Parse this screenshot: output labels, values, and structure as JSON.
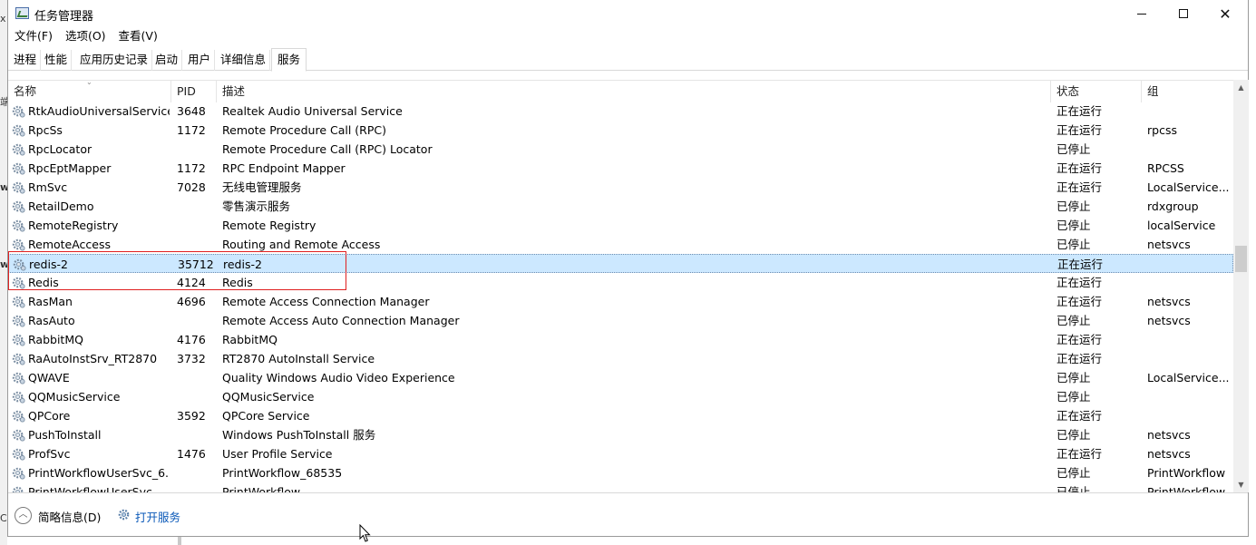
{
  "window": {
    "title": "任务管理器",
    "controls": {
      "minimize": "minimize",
      "maximize": "maximize",
      "close": "✕"
    }
  },
  "menu": [
    "文件(F)",
    "选项(O)",
    "查看(V)"
  ],
  "tabs": [
    "进程",
    "性能",
    "应用历史记录",
    "启动",
    "用户",
    "详细信息",
    "服务"
  ],
  "active_tab": "服务",
  "columns": {
    "name": "名称",
    "pid": "PID",
    "description": "描述",
    "status": "状态",
    "group": "组"
  },
  "rows": [
    {
      "name": "RtkAudioUniversalService",
      "pid": "3648",
      "description": "Realtek Audio Universal Service",
      "status": "正在运行",
      "group": ""
    },
    {
      "name": "RpcSs",
      "pid": "1172",
      "description": "Remote Procedure Call (RPC)",
      "status": "正在运行",
      "group": "rpcss"
    },
    {
      "name": "RpcLocator",
      "pid": "",
      "description": "Remote Procedure Call (RPC) Locator",
      "status": "已停止",
      "group": ""
    },
    {
      "name": "RpcEptMapper",
      "pid": "1172",
      "description": "RPC Endpoint Mapper",
      "status": "正在运行",
      "group": "RPCSS"
    },
    {
      "name": "RmSvc",
      "pid": "7028",
      "description": "无线电管理服务",
      "status": "正在运行",
      "group": "LocalService..."
    },
    {
      "name": "RetailDemo",
      "pid": "",
      "description": "零售演示服务",
      "status": "已停止",
      "group": "rdxgroup"
    },
    {
      "name": "RemoteRegistry",
      "pid": "",
      "description": "Remote Registry",
      "status": "已停止",
      "group": "localService"
    },
    {
      "name": "RemoteAccess",
      "pid": "",
      "description": "Routing and Remote Access",
      "status": "已停止",
      "group": "netsvcs"
    },
    {
      "name": "redis-2",
      "pid": "35712",
      "description": "redis-2",
      "status": "正在运行",
      "group": "",
      "selected": true
    },
    {
      "name": "Redis",
      "pid": "4124",
      "description": "Redis",
      "status": "正在运行",
      "group": ""
    },
    {
      "name": "RasMan",
      "pid": "4696",
      "description": "Remote Access Connection Manager",
      "status": "正在运行",
      "group": "netsvcs"
    },
    {
      "name": "RasAuto",
      "pid": "",
      "description": "Remote Access Auto Connection Manager",
      "status": "已停止",
      "group": "netsvcs"
    },
    {
      "name": "RabbitMQ",
      "pid": "4176",
      "description": "RabbitMQ",
      "status": "正在运行",
      "group": ""
    },
    {
      "name": "RaAutoInstSrv_RT2870",
      "pid": "3732",
      "description": "RT2870 AutoInstall Service",
      "status": "正在运行",
      "group": ""
    },
    {
      "name": "QWAVE",
      "pid": "",
      "description": "Quality Windows Audio Video Experience",
      "status": "已停止",
      "group": "LocalService..."
    },
    {
      "name": "QQMusicService",
      "pid": "",
      "description": "QQMusicService",
      "status": "已停止",
      "group": ""
    },
    {
      "name": "QPCore",
      "pid": "3592",
      "description": "QPCore Service",
      "status": "正在运行",
      "group": ""
    },
    {
      "name": "PushToInstall",
      "pid": "",
      "description": "Windows PushToInstall 服务",
      "status": "已停止",
      "group": "netsvcs"
    },
    {
      "name": "ProfSvc",
      "pid": "1476",
      "description": "User Profile Service",
      "status": "正在运行",
      "group": "netsvcs"
    },
    {
      "name": "PrintWorkflowUserSvc_6...",
      "pid": "",
      "description": "PrintWorkflow_68535",
      "status": "已停止",
      "group": "PrintWorkflow"
    },
    {
      "name": "PrintWorkflowUserSvc",
      "pid": "",
      "description": "PrintWorkflow",
      "status": "已停止",
      "group": "PrintWorkflow"
    }
  ],
  "footer": {
    "fewer_details": "简略信息(D)",
    "open_services": "打开服务"
  },
  "background_fragments": [
    "x",
    "端",
    "w",
    "w",
    "C"
  ],
  "colors": {
    "selection": "#cce8ff",
    "highlight_box": "#e02020",
    "link": "#0a58b8"
  }
}
